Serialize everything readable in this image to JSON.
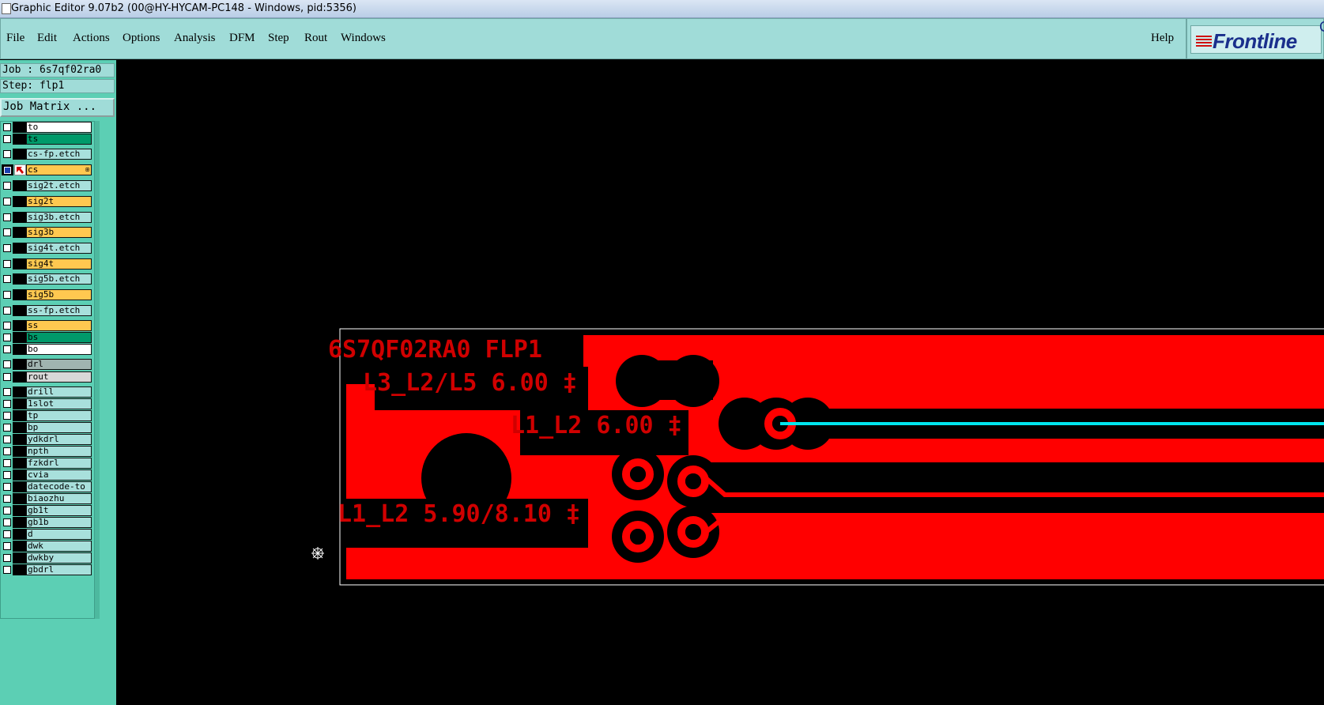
{
  "window": {
    "title": "Graphic Editor 9.07b2 (00@HY-HYCAM-PC148 - Windows, pid:5356)"
  },
  "menu": {
    "items": [
      "File",
      "Edit",
      "Actions",
      "Options",
      "Analysis",
      "DFM",
      "Step",
      "Rout",
      "Windows"
    ],
    "help": "Help"
  },
  "logo": {
    "text": "Frontline",
    "ext": "C"
  },
  "job": {
    "job_label": "Job : 6s7qf02ra0",
    "step_label": "Step: flp1",
    "matrix_button": "Job Matrix ..."
  },
  "colors": {
    "board_copper": "#ff0000",
    "trace_cyan": "#00e5ee",
    "canvas_bg": "#000000",
    "menu_bg": "#a0dcd8",
    "side_bg": "#5ccfb4"
  },
  "layers": [
    {
      "name": "to",
      "color": "#ffffff"
    },
    {
      "name": "ts",
      "color": "#009a6a"
    },
    {
      "name": "cs-fp.etch",
      "color": "#a8e0dc"
    },
    {
      "name": "cs",
      "color": "#ffc850",
      "active": true
    },
    {
      "name": "sig2t.etch",
      "color": "#a8e0dc"
    },
    {
      "name": "sig2t",
      "color": "#ffc850"
    },
    {
      "name": "sig3b.etch",
      "color": "#a8e0dc"
    },
    {
      "name": "sig3b",
      "color": "#ffc850"
    },
    {
      "name": "sig4t.etch",
      "color": "#a8e0dc"
    },
    {
      "name": "sig4t",
      "color": "#ffc850"
    },
    {
      "name": "sig5b.etch",
      "color": "#a8e0dc"
    },
    {
      "name": "sig5b",
      "color": "#ffc850"
    },
    {
      "name": "ss-fp.etch",
      "color": "#a8e0dc"
    },
    {
      "name": "ss",
      "color": "#ffc850"
    },
    {
      "name": "bs",
      "color": "#009a6a"
    },
    {
      "name": "bo",
      "color": "#ffffff"
    },
    {
      "name": "drl",
      "color": "#a0b4b0"
    },
    {
      "name": "rout",
      "color": "#d8d8d8"
    },
    {
      "name": "drill",
      "color": "#a8e0dc"
    },
    {
      "name": "1slot",
      "color": "#a8e0dc"
    },
    {
      "name": "tp",
      "color": "#a8e0dc"
    },
    {
      "name": "bp",
      "color": "#a8e0dc"
    },
    {
      "name": "ydkdrl",
      "color": "#a8e0dc"
    },
    {
      "name": "npth",
      "color": "#a8e0dc"
    },
    {
      "name": "fzkdrl",
      "color": "#a8e0dc"
    },
    {
      "name": "cvia",
      "color": "#a8e0dc"
    },
    {
      "name": "datecode-to",
      "color": "#a8e0dc"
    },
    {
      "name": "biaozhu",
      "color": "#a8e0dc"
    },
    {
      "name": "gb1t",
      "color": "#a8e0dc"
    },
    {
      "name": "gb1b",
      "color": "#a8e0dc"
    },
    {
      "name": "d",
      "color": "#a8e0dc"
    },
    {
      "name": "dwk",
      "color": "#a8e0dc"
    },
    {
      "name": "dwkby",
      "color": "#a8e0dc"
    },
    {
      "name": "gbdrl",
      "color": "#a8e0dc"
    }
  ],
  "board": {
    "text_job": "6S7QF02RA0 FLP1",
    "text_l3": "L3_L2/L5 6.00 ‡",
    "text_l1a": "L1_L2 6.00 ‡",
    "text_l1b": "L1_L2 5.90/8.10 ‡"
  }
}
